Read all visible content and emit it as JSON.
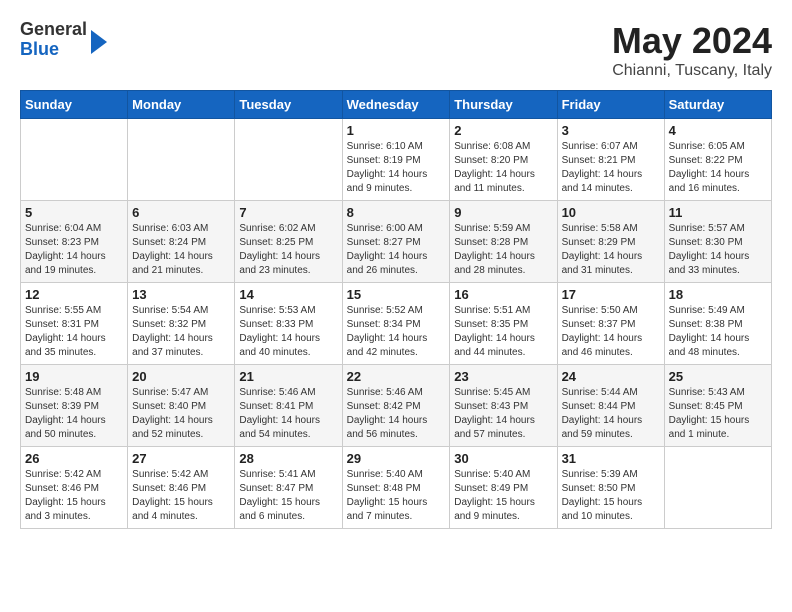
{
  "header": {
    "logo_general": "General",
    "logo_blue": "Blue",
    "title": "May 2024",
    "subtitle": "Chianni, Tuscany, Italy"
  },
  "columns": [
    "Sunday",
    "Monday",
    "Tuesday",
    "Wednesday",
    "Thursday",
    "Friday",
    "Saturday"
  ],
  "weeks": [
    [
      {
        "date": "",
        "sunrise": "",
        "sunset": "",
        "daylight": ""
      },
      {
        "date": "",
        "sunrise": "",
        "sunset": "",
        "daylight": ""
      },
      {
        "date": "",
        "sunrise": "",
        "sunset": "",
        "daylight": ""
      },
      {
        "date": "1",
        "sunrise": "Sunrise: 6:10 AM",
        "sunset": "Sunset: 8:19 PM",
        "daylight": "Daylight: 14 hours and 9 minutes."
      },
      {
        "date": "2",
        "sunrise": "Sunrise: 6:08 AM",
        "sunset": "Sunset: 8:20 PM",
        "daylight": "Daylight: 14 hours and 11 minutes."
      },
      {
        "date": "3",
        "sunrise": "Sunrise: 6:07 AM",
        "sunset": "Sunset: 8:21 PM",
        "daylight": "Daylight: 14 hours and 14 minutes."
      },
      {
        "date": "4",
        "sunrise": "Sunrise: 6:05 AM",
        "sunset": "Sunset: 8:22 PM",
        "daylight": "Daylight: 14 hours and 16 minutes."
      }
    ],
    [
      {
        "date": "5",
        "sunrise": "Sunrise: 6:04 AM",
        "sunset": "Sunset: 8:23 PM",
        "daylight": "Daylight: 14 hours and 19 minutes."
      },
      {
        "date": "6",
        "sunrise": "Sunrise: 6:03 AM",
        "sunset": "Sunset: 8:24 PM",
        "daylight": "Daylight: 14 hours and 21 minutes."
      },
      {
        "date": "7",
        "sunrise": "Sunrise: 6:02 AM",
        "sunset": "Sunset: 8:25 PM",
        "daylight": "Daylight: 14 hours and 23 minutes."
      },
      {
        "date": "8",
        "sunrise": "Sunrise: 6:00 AM",
        "sunset": "Sunset: 8:27 PM",
        "daylight": "Daylight: 14 hours and 26 minutes."
      },
      {
        "date": "9",
        "sunrise": "Sunrise: 5:59 AM",
        "sunset": "Sunset: 8:28 PM",
        "daylight": "Daylight: 14 hours and 28 minutes."
      },
      {
        "date": "10",
        "sunrise": "Sunrise: 5:58 AM",
        "sunset": "Sunset: 8:29 PM",
        "daylight": "Daylight: 14 hours and 31 minutes."
      },
      {
        "date": "11",
        "sunrise": "Sunrise: 5:57 AM",
        "sunset": "Sunset: 8:30 PM",
        "daylight": "Daylight: 14 hours and 33 minutes."
      }
    ],
    [
      {
        "date": "12",
        "sunrise": "Sunrise: 5:55 AM",
        "sunset": "Sunset: 8:31 PM",
        "daylight": "Daylight: 14 hours and 35 minutes."
      },
      {
        "date": "13",
        "sunrise": "Sunrise: 5:54 AM",
        "sunset": "Sunset: 8:32 PM",
        "daylight": "Daylight: 14 hours and 37 minutes."
      },
      {
        "date": "14",
        "sunrise": "Sunrise: 5:53 AM",
        "sunset": "Sunset: 8:33 PM",
        "daylight": "Daylight: 14 hours and 40 minutes."
      },
      {
        "date": "15",
        "sunrise": "Sunrise: 5:52 AM",
        "sunset": "Sunset: 8:34 PM",
        "daylight": "Daylight: 14 hours and 42 minutes."
      },
      {
        "date": "16",
        "sunrise": "Sunrise: 5:51 AM",
        "sunset": "Sunset: 8:35 PM",
        "daylight": "Daylight: 14 hours and 44 minutes."
      },
      {
        "date": "17",
        "sunrise": "Sunrise: 5:50 AM",
        "sunset": "Sunset: 8:37 PM",
        "daylight": "Daylight: 14 hours and 46 minutes."
      },
      {
        "date": "18",
        "sunrise": "Sunrise: 5:49 AM",
        "sunset": "Sunset: 8:38 PM",
        "daylight": "Daylight: 14 hours and 48 minutes."
      }
    ],
    [
      {
        "date": "19",
        "sunrise": "Sunrise: 5:48 AM",
        "sunset": "Sunset: 8:39 PM",
        "daylight": "Daylight: 14 hours and 50 minutes."
      },
      {
        "date": "20",
        "sunrise": "Sunrise: 5:47 AM",
        "sunset": "Sunset: 8:40 PM",
        "daylight": "Daylight: 14 hours and 52 minutes."
      },
      {
        "date": "21",
        "sunrise": "Sunrise: 5:46 AM",
        "sunset": "Sunset: 8:41 PM",
        "daylight": "Daylight: 14 hours and 54 minutes."
      },
      {
        "date": "22",
        "sunrise": "Sunrise: 5:46 AM",
        "sunset": "Sunset: 8:42 PM",
        "daylight": "Daylight: 14 hours and 56 minutes."
      },
      {
        "date": "23",
        "sunrise": "Sunrise: 5:45 AM",
        "sunset": "Sunset: 8:43 PM",
        "daylight": "Daylight: 14 hours and 57 minutes."
      },
      {
        "date": "24",
        "sunrise": "Sunrise: 5:44 AM",
        "sunset": "Sunset: 8:44 PM",
        "daylight": "Daylight: 14 hours and 59 minutes."
      },
      {
        "date": "25",
        "sunrise": "Sunrise: 5:43 AM",
        "sunset": "Sunset: 8:45 PM",
        "daylight": "Daylight: 15 hours and 1 minute."
      }
    ],
    [
      {
        "date": "26",
        "sunrise": "Sunrise: 5:42 AM",
        "sunset": "Sunset: 8:46 PM",
        "daylight": "Daylight: 15 hours and 3 minutes."
      },
      {
        "date": "27",
        "sunrise": "Sunrise: 5:42 AM",
        "sunset": "Sunset: 8:46 PM",
        "daylight": "Daylight: 15 hours and 4 minutes."
      },
      {
        "date": "28",
        "sunrise": "Sunrise: 5:41 AM",
        "sunset": "Sunset: 8:47 PM",
        "daylight": "Daylight: 15 hours and 6 minutes."
      },
      {
        "date": "29",
        "sunrise": "Sunrise: 5:40 AM",
        "sunset": "Sunset: 8:48 PM",
        "daylight": "Daylight: 15 hours and 7 minutes."
      },
      {
        "date": "30",
        "sunrise": "Sunrise: 5:40 AM",
        "sunset": "Sunset: 8:49 PM",
        "daylight": "Daylight: 15 hours and 9 minutes."
      },
      {
        "date": "31",
        "sunrise": "Sunrise: 5:39 AM",
        "sunset": "Sunset: 8:50 PM",
        "daylight": "Daylight: 15 hours and 10 minutes."
      },
      {
        "date": "",
        "sunrise": "",
        "sunset": "",
        "daylight": ""
      }
    ]
  ]
}
